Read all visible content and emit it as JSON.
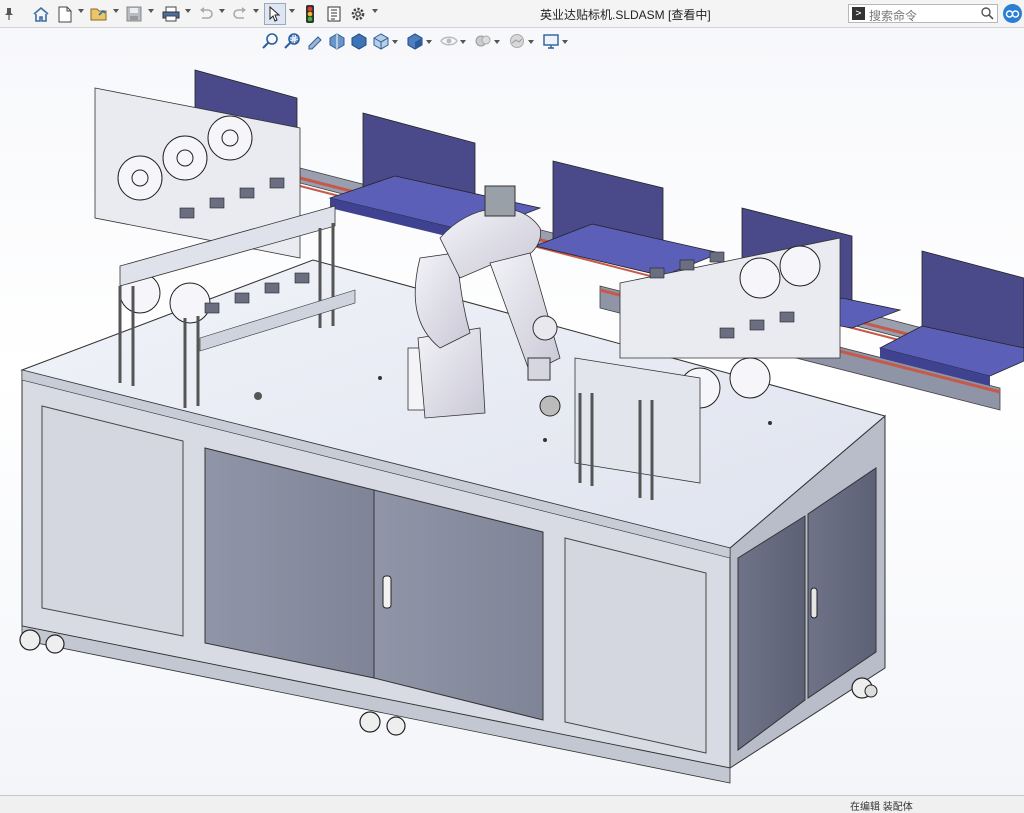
{
  "document": {
    "title": "英业达贴标机.SLDASM [查看中]"
  },
  "search": {
    "prompt_icon": "command-prompt-icon",
    "placeholder": "搜索命令"
  },
  "toolbar": {
    "icons": [
      "pin-icon",
      "home-icon",
      "new-file-icon",
      "open-file-icon",
      "save-icon",
      "print-icon",
      "undo-icon",
      "redo-icon",
      "select-cursor-icon",
      "traffic-light-icon",
      "file-properties-icon",
      "options-gear-icon"
    ]
  },
  "view_hud": {
    "icons": [
      "zoom-to-fit-icon",
      "zoom-area-icon",
      "previous-view-icon",
      "section-view-icon",
      "dynamic-annotation-icon",
      "view-orientation-icon",
      "display-style-icon",
      "hide-show-items-icon",
      "edit-appearance-icon",
      "apply-scene-icon",
      "view-settings-icon"
    ]
  },
  "status": {
    "text": "在编辑 装配体"
  },
  "colors": {
    "cabinet_body": "#d8dbe3",
    "cabinet_door": "#8e94a6",
    "table_top": "#e8ebf3",
    "tray_blue": "#5b5fb8",
    "tray_panel": "#4a4a8a",
    "robot": "#dcdce6",
    "rail_red": "#c65a4a"
  }
}
